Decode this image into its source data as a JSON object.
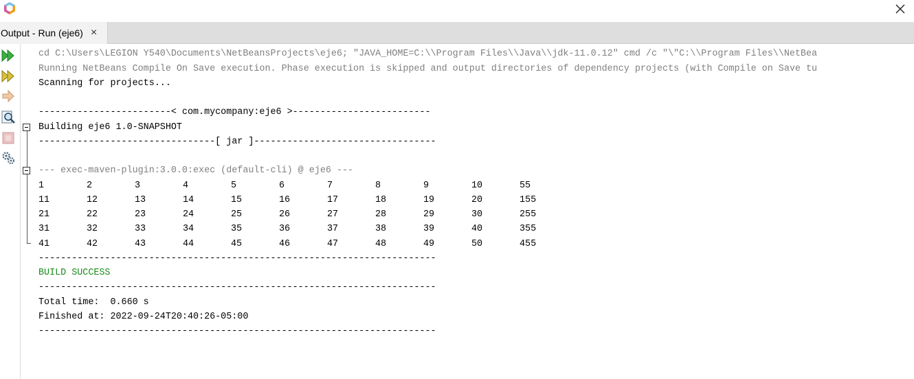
{
  "window": {
    "logo_icon": "netbeans-cube-icon",
    "close_icon": "close-icon"
  },
  "tab": {
    "label": "Output - Run (eje6)",
    "close": "×"
  },
  "toolbar": {
    "items": [
      {
        "name": "rerun-icon"
      },
      {
        "name": "rerun-with-options-icon"
      },
      {
        "name": "next-step-icon"
      },
      {
        "name": "find-icon"
      },
      {
        "name": "stop-icon"
      },
      {
        "name": "settings-icon"
      }
    ]
  },
  "output": {
    "lines": {
      "cmd": "cd C:\\Users\\LEGION Y540\\Documents\\NetBeansProjects\\eje6; \"JAVA_HOME=C:\\\\Program Files\\\\Java\\\\jdk-11.0.12\" cmd /c \"\\\"C:\\\\Program Files\\\\NetBea",
      "compile": "Running NetBeans Compile On Save execution. Phase execution is skipped and output directories of dependency projects (with Compile on Save tu",
      "scanning": "Scanning for projects...",
      "project_header": "------------------------< com.mycompany:eje6 >-------------------------",
      "building": "Building eje6 1.0-SNAPSHOT",
      "jar_sep": "--------------------------------[ jar ]---------------------------------",
      "plugin": "--- exec-maven-plugin:3.0.0:exec (default-cli) @ eje6 ---",
      "sep1": "------------------------------------------------------------------------",
      "build_success": "BUILD SUCCESS",
      "sep2": "------------------------------------------------------------------------",
      "total_time": "Total time:  0.660 s",
      "finished_at": "Finished at: 2022-09-24T20:40:26-05:00",
      "sep3": "------------------------------------------------------------------------"
    },
    "table": [
      [
        "1",
        "2",
        "3",
        "4",
        "5",
        "6",
        "7",
        "8",
        "9",
        "10",
        "55"
      ],
      [
        "11",
        "12",
        "13",
        "14",
        "15",
        "16",
        "17",
        "18",
        "19",
        "20",
        "155"
      ],
      [
        "21",
        "22",
        "23",
        "24",
        "25",
        "26",
        "27",
        "28",
        "29",
        "30",
        "255"
      ],
      [
        "31",
        "32",
        "33",
        "34",
        "35",
        "36",
        "37",
        "38",
        "39",
        "40",
        "355"
      ],
      [
        "41",
        "42",
        "43",
        "44",
        "45",
        "46",
        "47",
        "48",
        "49",
        "50",
        "455"
      ]
    ]
  },
  "colors": {
    "success": "#1a8a1a",
    "muted": "#808080"
  }
}
